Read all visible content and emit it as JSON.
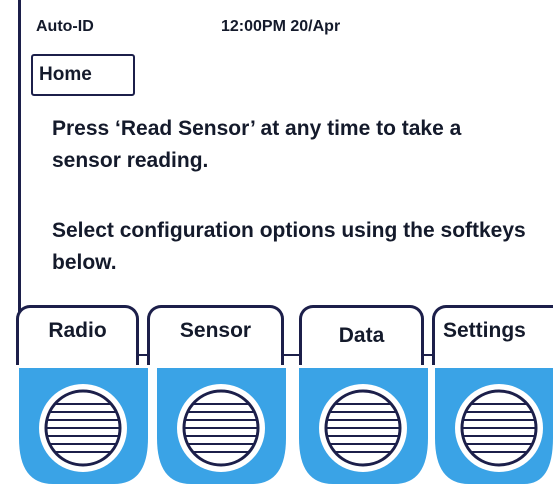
{
  "status_bar": {
    "app_name": "Auto-ID",
    "datetime": "12:00PM 20/Apr"
  },
  "screen_title": "Home",
  "messages": [
    "Press ‘Read Sensor’ at any time to take a sensor reading.",
    "Select configuration options using the softkeys below."
  ],
  "softkeys": [
    {
      "label": "Radio",
      "icon": "softkey-button-icon"
    },
    {
      "label": "Sensor",
      "icon": "softkey-button-icon"
    },
    {
      "label": "Data",
      "icon": "softkey-button-icon"
    },
    {
      "label": "Settings",
      "icon": "softkey-button-icon"
    }
  ],
  "colors": {
    "softkey_fill": "#3aa3e6",
    "frame": "#1c1f4a",
    "text": "#141a2b"
  }
}
